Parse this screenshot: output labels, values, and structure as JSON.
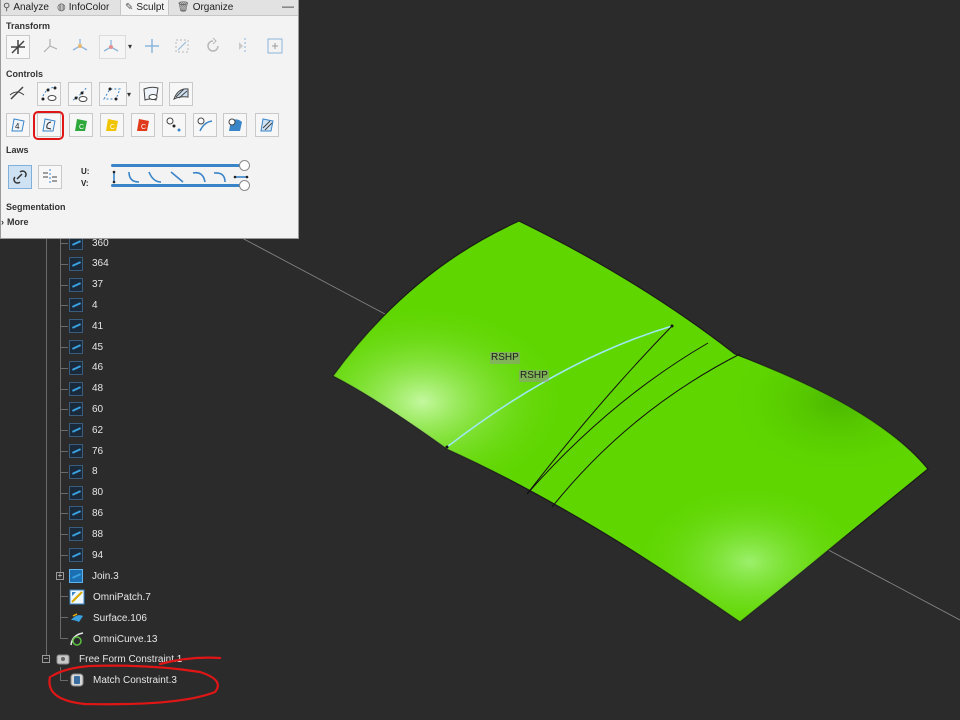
{
  "tabs": [
    {
      "label": "Analyze",
      "icon": "analyze-icon"
    },
    {
      "label": "InfoColor",
      "icon": "palette-icon"
    },
    {
      "label": "Sculpt",
      "icon": "brush-icon",
      "active": true
    },
    {
      "label": "Organize",
      "icon": "trash-icon"
    }
  ],
  "close_glyph": "—",
  "sections": {
    "transform": "Transform",
    "controls": "Controls",
    "laws": "Laws",
    "segmentation": "Segmentation",
    "more": "More"
  },
  "laws": {
    "u_label": "U:",
    "v_label": "V:"
  },
  "tree": {
    "items": [
      "360",
      "364",
      "37",
      "4",
      "41",
      "45",
      "46",
      "48",
      "60",
      "62",
      "76",
      "8",
      "80",
      "86",
      "88",
      "94"
    ],
    "join": "Join.3",
    "omnipatch": "OmniPatch.7",
    "surface": "Surface.106",
    "omnicurve": "OmniCurve.13",
    "constraint": "Free Form Constraint.1",
    "match": "Match Constraint.3"
  },
  "viewport": {
    "label1": "RSHP",
    "label2": "RSHP",
    "surface_color": "#5fd600",
    "background": "#2b2b2b"
  },
  "colors": {
    "highlight": "#e01616",
    "accent": "#3a85c8"
  }
}
